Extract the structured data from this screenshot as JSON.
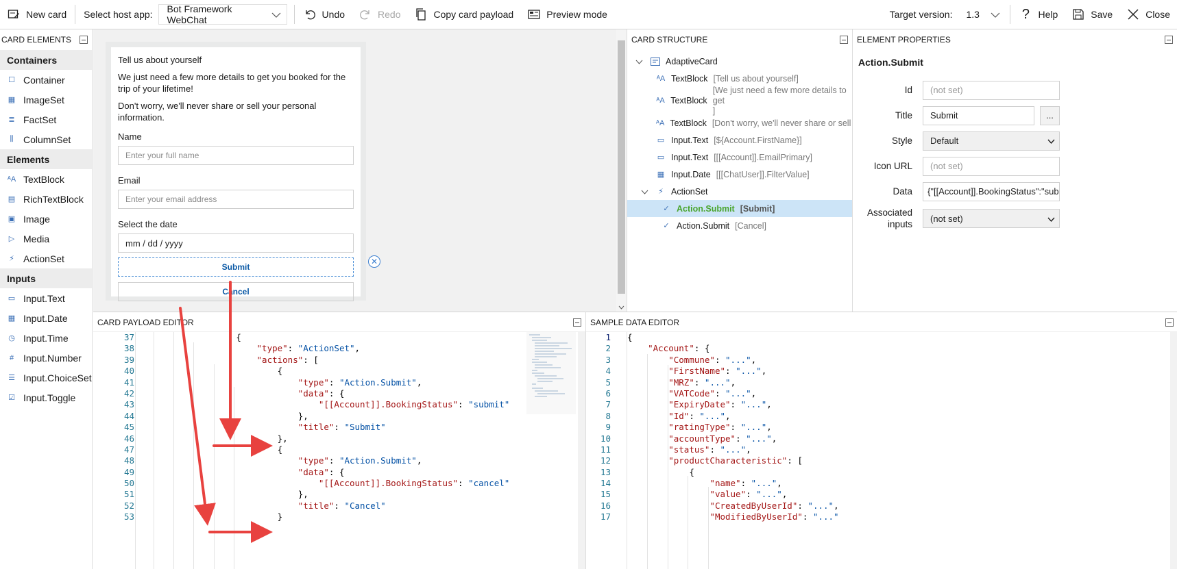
{
  "toolbar": {
    "new_card": "New card",
    "host_label": "Select host app:",
    "host_value": "Bot Framework WebChat",
    "undo": "Undo",
    "redo": "Redo",
    "copy_payload": "Copy card payload",
    "preview": "Preview mode",
    "target_label": "Target version:",
    "target_value": "1.3",
    "help": "Help",
    "save": "Save",
    "close": "Close"
  },
  "palette": {
    "title": "CARD ELEMENTS",
    "groups": [
      {
        "name": "Containers",
        "items": [
          "Container",
          "ImageSet",
          "FactSet",
          "ColumnSet"
        ]
      },
      {
        "name": "Elements",
        "items": [
          "TextBlock",
          "RichTextBlock",
          "Image",
          "Media",
          "ActionSet"
        ]
      },
      {
        "name": "Inputs",
        "items": [
          "Input.Text",
          "Input.Date",
          "Input.Time",
          "Input.Number",
          "Input.ChoiceSet",
          "Input.Toggle"
        ]
      }
    ]
  },
  "card": {
    "heading": "Tell us about yourself",
    "intro": "We just need a few more details to get you booked for the trip of your lifetime!",
    "privacy": "Don't worry, we'll never share or sell your personal information.",
    "name_label": "Name",
    "name_placeholder": "Enter your full name",
    "email_label": "Email",
    "email_placeholder": "Enter your email address",
    "date_label": "Select the date",
    "date_placeholder": "mm / dd / yyyy",
    "submit": "Submit",
    "cancel": "Cancel"
  },
  "structure": {
    "title": "CARD STRUCTURE",
    "root": "AdaptiveCard",
    "items": [
      {
        "type": "TextBlock",
        "desc": "[Tell us about yourself]"
      },
      {
        "type": "TextBlock",
        "desc": "[We just need a few more details to get"
      },
      {
        "type": "TextBlock",
        "desc": "[Don't worry, we'll never share or sell you"
      },
      {
        "type": "Input.Text",
        "desc": "[${Account.FirstName}]"
      },
      {
        "type": "Input.Text",
        "desc": "[[[Account]].EmailPrimary]"
      },
      {
        "type": "Input.Date",
        "desc": "[[[ChatUser]].FilterValue]"
      }
    ],
    "item2_cont": "]",
    "actionset": "ActionSet",
    "actions": [
      {
        "type": "Action.Submit",
        "desc": "[Submit]"
      },
      {
        "type": "Action.Submit",
        "desc": "[Cancel]"
      }
    ]
  },
  "props": {
    "title": "ELEMENT PROPERTIES",
    "element": "Action.Submit",
    "id_label": "Id",
    "id_placeholder": "(not set)",
    "title_label": "Title",
    "title_value": "Submit",
    "more": "...",
    "style_label": "Style",
    "style_value": "Default",
    "icon_label": "Icon URL",
    "icon_placeholder": "(not set)",
    "data_label": "Data",
    "data_value": "{\"[[Account]].BookingStatus\":\"sub",
    "assoc_label": "Associated inputs",
    "assoc_value": "(not set)"
  },
  "payload_editor": {
    "title": "CARD PAYLOAD EDITOR",
    "lines": [
      {
        "n": "37",
        "indent": 4,
        "parts": [
          [
            "p",
            "{"
          ]
        ]
      },
      {
        "n": "38",
        "indent": 5,
        "parts": [
          [
            "k",
            "\"type\""
          ],
          [
            "p",
            ": "
          ],
          [
            "s",
            "\"ActionSet\""
          ],
          [
            "p",
            ","
          ]
        ]
      },
      {
        "n": "39",
        "indent": 5,
        "parts": [
          [
            "k",
            "\"actions\""
          ],
          [
            "p",
            ": ["
          ]
        ]
      },
      {
        "n": "40",
        "indent": 6,
        "parts": [
          [
            "p",
            "{"
          ]
        ]
      },
      {
        "n": "41",
        "indent": 7,
        "parts": [
          [
            "k",
            "\"type\""
          ],
          [
            "p",
            ": "
          ],
          [
            "s",
            "\"Action.Submit\""
          ],
          [
            "p",
            ","
          ]
        ]
      },
      {
        "n": "42",
        "indent": 7,
        "parts": [
          [
            "k",
            "\"data\""
          ],
          [
            "p",
            ": {"
          ]
        ]
      },
      {
        "n": "43",
        "indent": 8,
        "parts": [
          [
            "k",
            "\"[[Account]].BookingStatus\""
          ],
          [
            "p",
            ": "
          ],
          [
            "s",
            "\"submit\""
          ]
        ]
      },
      {
        "n": "44",
        "indent": 7,
        "parts": [
          [
            "p",
            "},"
          ]
        ]
      },
      {
        "n": "45",
        "indent": 7,
        "parts": [
          [
            "k",
            "\"title\""
          ],
          [
            "p",
            ": "
          ],
          [
            "s",
            "\"Submit\""
          ]
        ]
      },
      {
        "n": "46",
        "indent": 6,
        "parts": [
          [
            "p",
            "},"
          ]
        ]
      },
      {
        "n": "47",
        "indent": 6,
        "parts": [
          [
            "p",
            "{"
          ]
        ]
      },
      {
        "n": "48",
        "indent": 7,
        "parts": [
          [
            "k",
            "\"type\""
          ],
          [
            "p",
            ": "
          ],
          [
            "s",
            "\"Action.Submit\""
          ],
          [
            "p",
            ","
          ]
        ]
      },
      {
        "n": "49",
        "indent": 7,
        "parts": [
          [
            "k",
            "\"data\""
          ],
          [
            "p",
            ": {"
          ]
        ]
      },
      {
        "n": "50",
        "indent": 8,
        "parts": [
          [
            "k",
            "\"[[Account]].BookingStatus\""
          ],
          [
            "p",
            ": "
          ],
          [
            "s",
            "\"cancel\""
          ]
        ]
      },
      {
        "n": "51",
        "indent": 7,
        "parts": [
          [
            "p",
            "},"
          ]
        ]
      },
      {
        "n": "52",
        "indent": 7,
        "parts": [
          [
            "k",
            "\"title\""
          ],
          [
            "p",
            ": "
          ],
          [
            "s",
            "\"Cancel\""
          ]
        ]
      },
      {
        "n": "53",
        "indent": 6,
        "parts": [
          [
            "p",
            "}"
          ]
        ]
      }
    ]
  },
  "sample_editor": {
    "title": "SAMPLE DATA EDITOR",
    "lines": [
      {
        "n": "1",
        "indent": 0,
        "parts": [
          [
            "p",
            "{"
          ]
        ]
      },
      {
        "n": "2",
        "indent": 1,
        "parts": [
          [
            "k",
            "\"Account\""
          ],
          [
            "p",
            ": {"
          ]
        ]
      },
      {
        "n": "3",
        "indent": 2,
        "parts": [
          [
            "k",
            "\"Commune\""
          ],
          [
            "p",
            ": "
          ],
          [
            "s",
            "\"...\""
          ],
          [
            "p",
            ","
          ]
        ]
      },
      {
        "n": "4",
        "indent": 2,
        "parts": [
          [
            "k",
            "\"FirstName\""
          ],
          [
            "p",
            ": "
          ],
          [
            "s",
            "\"...\""
          ],
          [
            "p",
            ","
          ]
        ]
      },
      {
        "n": "5",
        "indent": 2,
        "parts": [
          [
            "k",
            "\"MRZ\""
          ],
          [
            "p",
            ": "
          ],
          [
            "s",
            "\"...\""
          ],
          [
            "p",
            ","
          ]
        ]
      },
      {
        "n": "6",
        "indent": 2,
        "parts": [
          [
            "k",
            "\"VATCode\""
          ],
          [
            "p",
            ": "
          ],
          [
            "s",
            "\"...\""
          ],
          [
            "p",
            ","
          ]
        ]
      },
      {
        "n": "7",
        "indent": 2,
        "parts": [
          [
            "k",
            "\"ExpiryDate\""
          ],
          [
            "p",
            ": "
          ],
          [
            "s",
            "\"...\""
          ],
          [
            "p",
            ","
          ]
        ]
      },
      {
        "n": "8",
        "indent": 2,
        "parts": [
          [
            "k",
            "\"Id\""
          ],
          [
            "p",
            ": "
          ],
          [
            "s",
            "\"...\""
          ],
          [
            "p",
            ","
          ]
        ]
      },
      {
        "n": "9",
        "indent": 2,
        "parts": [
          [
            "k",
            "\"ratingType\""
          ],
          [
            "p",
            ": "
          ],
          [
            "s",
            "\"...\""
          ],
          [
            "p",
            ","
          ]
        ]
      },
      {
        "n": "10",
        "indent": 2,
        "parts": [
          [
            "k",
            "\"accountType\""
          ],
          [
            "p",
            ": "
          ],
          [
            "s",
            "\"...\""
          ],
          [
            "p",
            ","
          ]
        ]
      },
      {
        "n": "11",
        "indent": 2,
        "parts": [
          [
            "k",
            "\"status\""
          ],
          [
            "p",
            ": "
          ],
          [
            "s",
            "\"...\""
          ],
          [
            "p",
            ","
          ]
        ]
      },
      {
        "n": "12",
        "indent": 2,
        "parts": [
          [
            "k",
            "\"productCharacteristic\""
          ],
          [
            "p",
            ": ["
          ]
        ]
      },
      {
        "n": "13",
        "indent": 3,
        "parts": [
          [
            "p",
            "{"
          ]
        ]
      },
      {
        "n": "14",
        "indent": 4,
        "parts": [
          [
            "k",
            "\"name\""
          ],
          [
            "p",
            ": "
          ],
          [
            "s",
            "\"...\""
          ],
          [
            "p",
            ","
          ]
        ]
      },
      {
        "n": "15",
        "indent": 4,
        "parts": [
          [
            "k",
            "\"value\""
          ],
          [
            "p",
            ": "
          ],
          [
            "s",
            "\"...\""
          ],
          [
            "p",
            ","
          ]
        ]
      },
      {
        "n": "16",
        "indent": 4,
        "parts": [
          [
            "k",
            "\"CreatedByUserId\""
          ],
          [
            "p",
            ": "
          ],
          [
            "s",
            "\"...\""
          ],
          [
            "p",
            ","
          ]
        ]
      },
      {
        "n": "17",
        "indent": 4,
        "parts": [
          [
            "k",
            "\"ModifiedByUserId\""
          ],
          [
            "p",
            ": "
          ],
          [
            "s",
            "\"...\""
          ]
        ]
      }
    ]
  },
  "colors": {
    "accent": "#0c5aa6",
    "selected_row": "#cce4f7",
    "selected_text": "#4aa52e",
    "arrow": "#e8423f"
  }
}
